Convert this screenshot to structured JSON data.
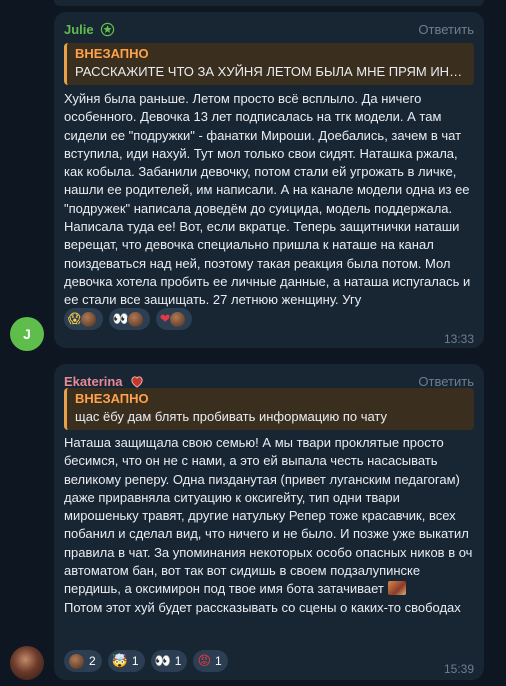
{
  "messages": [
    {
      "sender": "Julie",
      "sender_color": "#5fbe4b",
      "sender_badge_icon": "star-badge-icon",
      "reply_label": "Ответить",
      "quote": {
        "author": "ВНЕЗАПНО",
        "text": "РАССКАЖИТЕ ЧТО ЗА ХУЙНЯ ЛЕТОМ БЫЛА МНЕ ПРЯМ ИНТЕР..."
      },
      "body": "Хуйня была раньше. Летом просто всё всплыло. Да ничего особенного. Девочка 13 лет подписалась на тгк модели. А там сидели ее \"подружки\" - фанатки Мироши. Доебались, зачем в чат вступила, иди нахуй. Тут мол только свои сидят. Наташка ржала, как кобыла. Забанили девочку, потом стали ей угрожать в личке, нашли ее родителей, им написали. А на канале модели одна из ее \"подружек\" написала доведём до суицида, модель поддержала. Написала туда ее! Вот, если вкратце. Теперь защитнички наташи верещат, что девочка специально пришла к наташе на канал поиздеваться над ней, поэтому такая реакция была потом. Мол девочка хотела пробить ее личные данные, а наташа испугалась и ее стали все защищать. 27 летнюю женщину. Угу",
      "reactions": [
        {
          "emoji": "😱",
          "count": ""
        },
        {
          "emoji": "👀",
          "count": ""
        },
        {
          "emoji": "❤",
          "count": ""
        }
      ],
      "time": "13:33",
      "avatar_letter": "J",
      "avatar_color": "#5fbe4b"
    },
    {
      "sender": "Ekaterina",
      "sender_color": "#e68a96",
      "sender_badge_icon": "heart-badge-icon",
      "reply_label": "Ответить",
      "quote": {
        "author": "ВНЕЗАПНО",
        "text": "щас ёбу дам блять пробивать информацию по чату"
      },
      "body_part1": "Наташа защищала свою семью! А мы твари проклятые просто бесимся, что он не с нами, а это ей выпала честь насасывать великому реперу. Одна пизданутая (привет луганским педагогам) даже приравняла ситуацию к оксигейту, тип одни твари мирошеньку травят, другие натульку Репер тоже красавчик, всех побанил и сделал вид, что ничего и не было. И позже уже выкатил правила в чат. За упоминания некоторых особо опасных ников в оч автоматом бан, вот так вот сидишь в своем подзалупинске пердишь, а оксимирон под твое имя бота затачивает",
      "body_part2": "Потом этот хуй будет рассказывать со сцены о каких-то свободах",
      "reactions": [
        {
          "emoji": "❤",
          "count": "2"
        },
        {
          "emoji": "🤯",
          "count": "1"
        },
        {
          "emoji": "👀",
          "count": "1"
        },
        {
          "emoji": "😡",
          "count": "1"
        }
      ],
      "time": "15:39"
    }
  ]
}
